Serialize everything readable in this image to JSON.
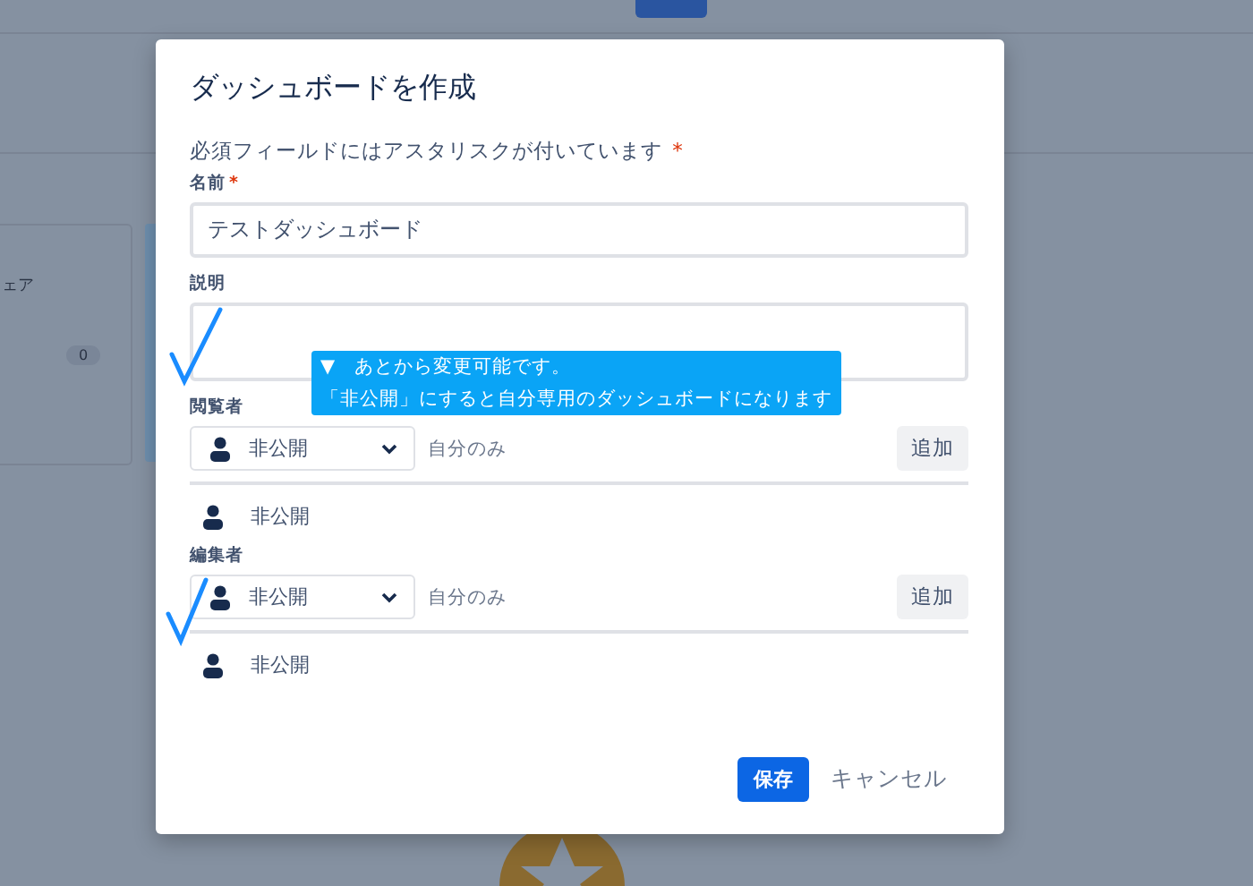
{
  "background": {
    "card_text": "ェア",
    "card_count": "0"
  },
  "dialog": {
    "title": "ダッシュボードを作成",
    "required_note": "必須フィールドにはアスタリスクが付いています",
    "required_mark": "*",
    "fields": [
      {
        "kind": "text",
        "label": "名前",
        "required": true,
        "value": "テストダッシュボード"
      },
      {
        "kind": "textarea",
        "label": "説明",
        "required": false
      }
    ],
    "permissions": [
      {
        "label": "閲覧者",
        "select": "非公開",
        "hint": "自分のみ",
        "add_button": "追加",
        "entries": [
          "非公開"
        ]
      },
      {
        "label": "編集者",
        "select": "非公開",
        "hint": "自分のみ",
        "add_button": "追加",
        "entries": [
          "非公開"
        ]
      }
    ],
    "buttons": [
      {
        "kind": "primary",
        "label": "保存"
      },
      {
        "kind": "link",
        "label": "キャンセル"
      }
    ]
  },
  "annotation": {
    "tooltip_lines": [
      "▼　あとから変更可能です。",
      "「非公開」にすると自分専用のダッシュボードになります"
    ]
  }
}
